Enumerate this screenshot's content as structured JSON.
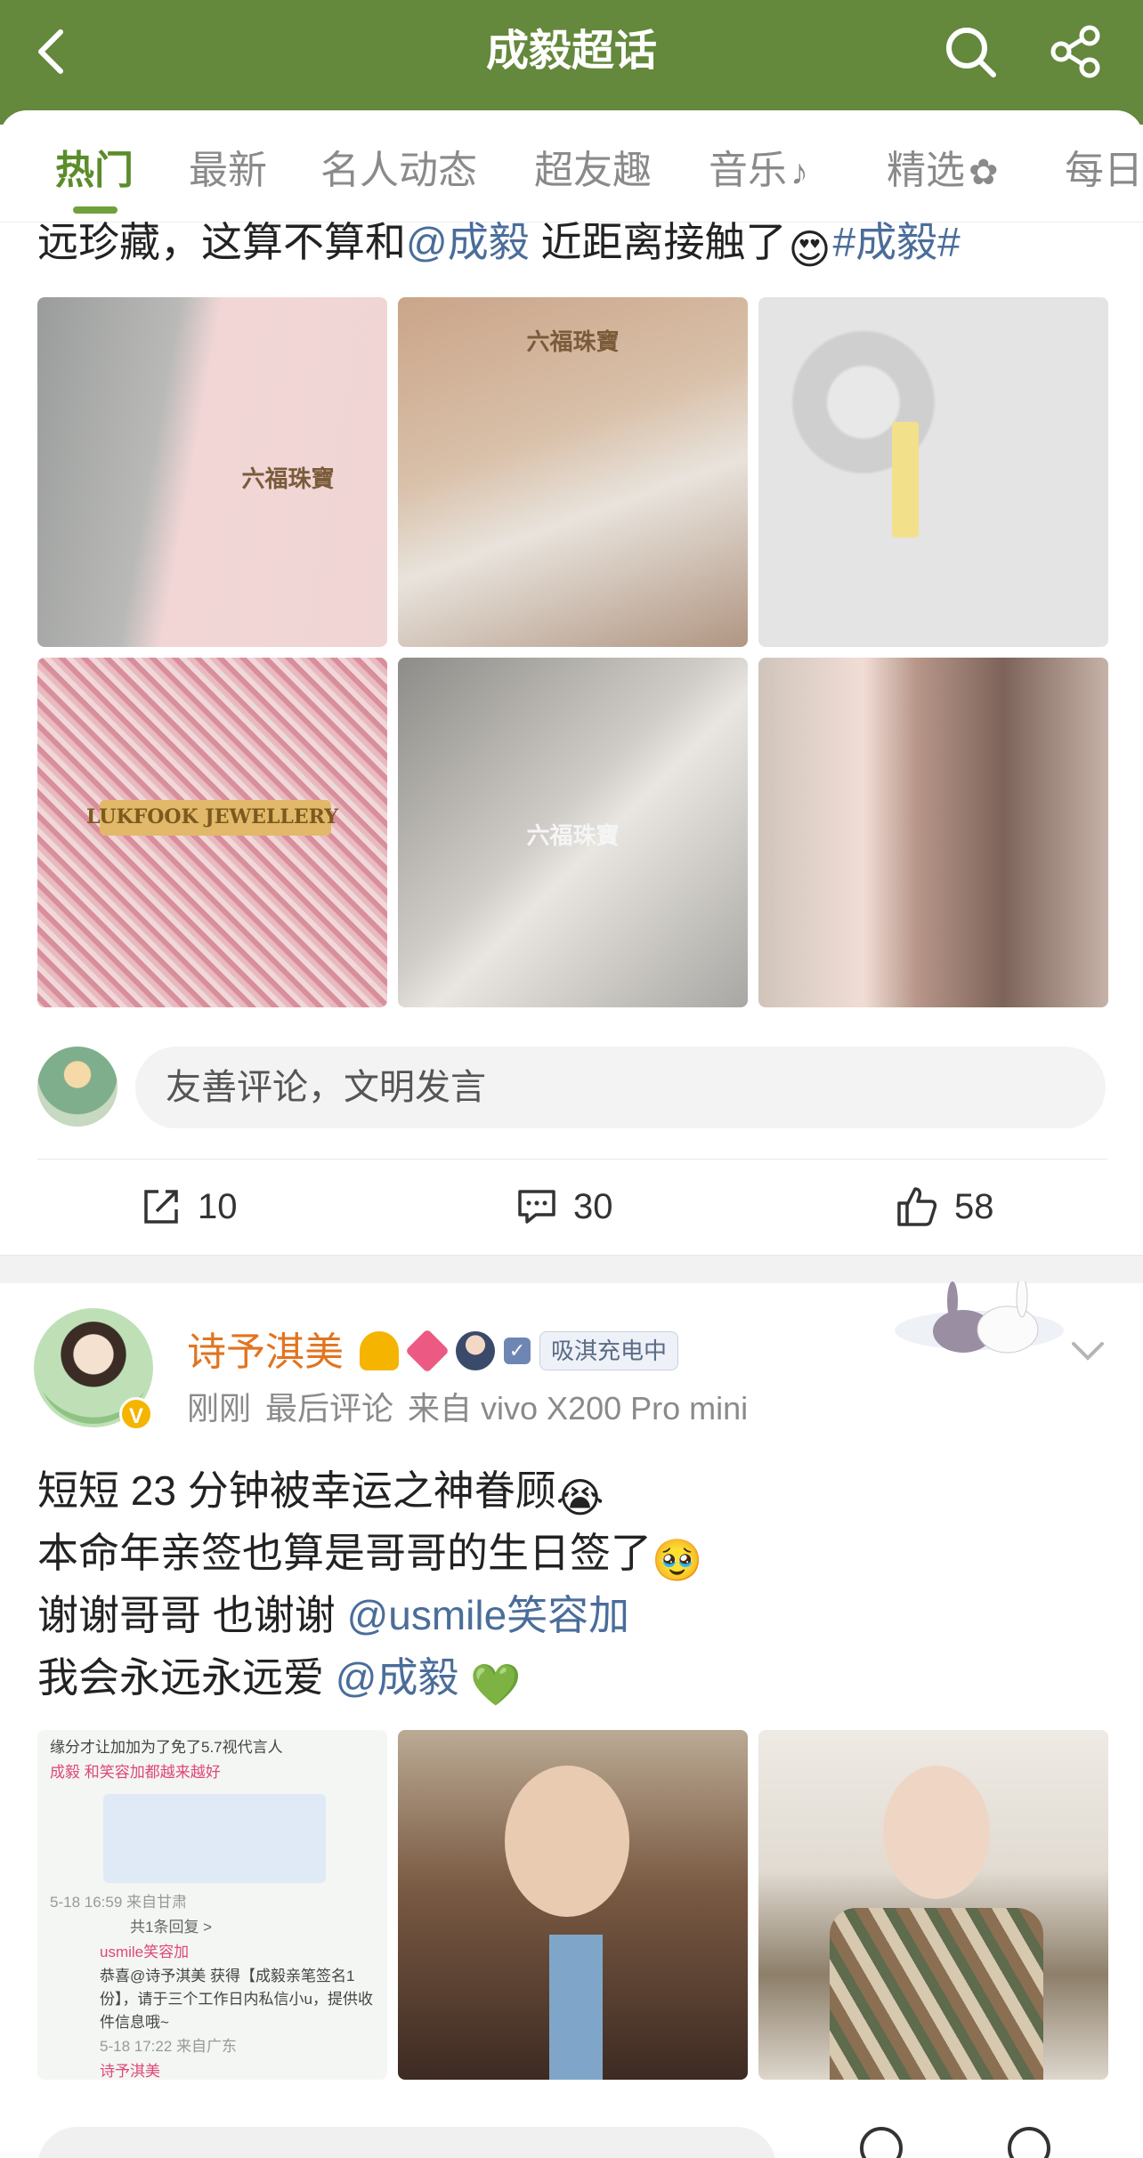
{
  "header": {
    "title": "成毅超话",
    "back_icon": "back-arrow-icon",
    "search_icon": "search-icon",
    "share_icon": "share-icon",
    "bg_color": "#64883c"
  },
  "tabs": [
    {
      "label": "热门",
      "active": true
    },
    {
      "label": "最新",
      "active": false
    },
    {
      "label": "名人动态",
      "active": false
    },
    {
      "label": "超友趣",
      "active": false
    },
    {
      "label": "音乐",
      "suffix": "♪",
      "active": false
    },
    {
      "label": "精选",
      "suffix": "✿",
      "active": false
    },
    {
      "label": "每日",
      "active": false
    }
  ],
  "post1": {
    "text_before": "远珍藏，这算不算和",
    "mention": "@成毅",
    "text_after": " 近距离接触了",
    "hashtag": "#成毅#",
    "images": [
      {
        "caption": "六福珠寶"
      },
      {
        "caption": "六福珠寶"
      },
      {
        "caption": ""
      },
      {
        "caption": "LUKFOOK JEWELLERY"
      },
      {
        "caption": "六福珠寶"
      },
      {
        "caption": ""
      }
    ],
    "comment_placeholder": "友善评论，文明发言",
    "actions": {
      "repost_count": "10",
      "comment_count": "30",
      "like_count": "58"
    }
  },
  "post2": {
    "username": "诗予淇美",
    "fan_tag": "吸淇充电中",
    "meta": {
      "time": "刚刚",
      "last_comment": "最后评论",
      "source": "来自 vivo X200 Pro mini"
    },
    "lines": [
      {
        "text": "短短 23 分钟被幸运之神眷顾",
        "emoji": "😭"
      },
      {
        "text": "本命年亲签也算是哥哥的生日签了",
        "emoji": "🥹"
      },
      {
        "text": "谢谢哥哥 也谢谢 ",
        "mention": "@usmile笑容加"
      },
      {
        "text": "我会永远永远爱 ",
        "mention": "@成毅",
        "emoji": "💚"
      }
    ],
    "screenshot": {
      "line1": "缘分才让加加为了免了5.7视代言人",
      "line2": "成毅 和笑容加都越来越好",
      "time1": "5-18 16:59  来自甘肃",
      "replies": "共1条回复 >",
      "brand": "usmile笑容加",
      "reply_text": "恭喜@诗予淇美 获得【成毅亲笔签名1份】，请于三个工作日内私信小u，提供收件信息哦~",
      "time2": "5-18 17:22  来自广东",
      "footer_user": "诗予淇美"
    }
  }
}
